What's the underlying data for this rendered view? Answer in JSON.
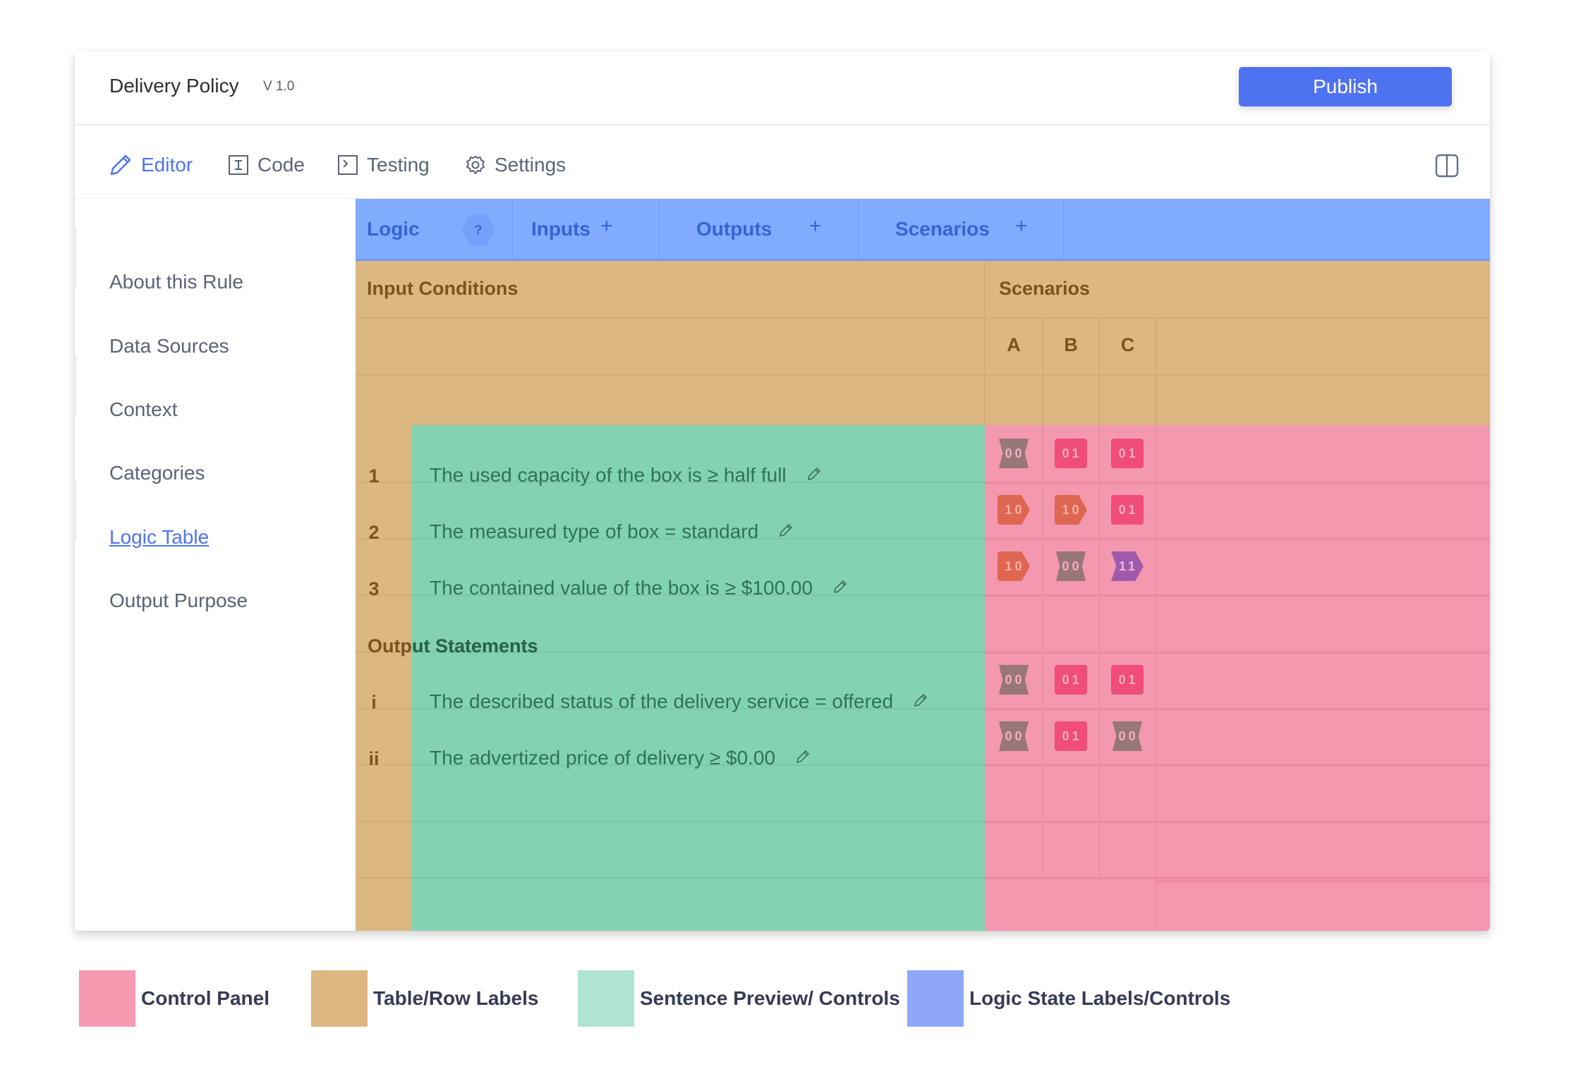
{
  "header": {
    "title": "Delivery Policy",
    "version": "V 1.0",
    "publish_label": "Publish"
  },
  "tabs": [
    {
      "label": "Editor",
      "icon": "pencil-icon",
      "active": true
    },
    {
      "label": "Code",
      "icon": "code-cursor-icon",
      "active": false
    },
    {
      "label": "Testing",
      "icon": "terminal-icon",
      "active": false
    },
    {
      "label": "Settings",
      "icon": "gear-icon",
      "active": false
    }
  ],
  "split_view_icon": "split-panel-icon",
  "sidebar": {
    "items": [
      {
        "label": "About this Rule",
        "active": false
      },
      {
        "label": "Data Sources",
        "active": false
      },
      {
        "label": "Context",
        "active": false
      },
      {
        "label": "Categories",
        "active": false
      },
      {
        "label": "Logic Table",
        "active": true
      },
      {
        "label": "Output Purpose",
        "active": false
      }
    ]
  },
  "logic_bar": {
    "logic_label": "Logic",
    "help_label": "?",
    "inputs_label": "Inputs",
    "outputs_label": "Outputs",
    "scenarios_label": "Scenarios",
    "add_label": "+"
  },
  "table": {
    "input_conditions_label": "Input Conditions",
    "scenarios_label": "Scenarios",
    "scenario_columns": [
      "A",
      "B",
      "C"
    ],
    "inputs": [
      {
        "number": "1",
        "sentence": "The used capacity of the box is ≥ half full",
        "states": [
          "00",
          "01",
          "01"
        ]
      },
      {
        "number": "2",
        "sentence": "The measured type of box = standard",
        "states": [
          "10",
          "10",
          "01"
        ]
      },
      {
        "number": "3",
        "sentence": "The contained value of the box is ≥ $100.00",
        "states": [
          "10",
          "00",
          "11"
        ]
      }
    ],
    "output_statements_label": "Output Statements",
    "outputs": [
      {
        "number": "i",
        "sentence": "The described status of the delivery service = offered",
        "states": [
          "00",
          "01",
          "01"
        ]
      },
      {
        "number": "ii",
        "sentence": "The advertized price of delivery ≥ $0.00",
        "states": [
          "00",
          "01",
          "00"
        ]
      }
    ]
  },
  "legend": [
    {
      "label": "Control Panel",
      "color": "#f59ab1"
    },
    {
      "label": "Table/Row Labels",
      "color": "#dcb781"
    },
    {
      "label": "Sentence Preview/ Controls",
      "color": "#b0e3d1"
    },
    {
      "label": "Logic State Labels/Controls",
      "color": "#8ea7f7"
    }
  ],
  "colors": {
    "accent": "#4f73f0",
    "control_panel": "#f398af",
    "row_labels": "#dcb781",
    "sentence_preview": "#83d3b3",
    "logic_state": "#80abff",
    "state_00": "#987777",
    "state_01": "#f04d78",
    "state_10": "#df6650",
    "state_11": "#a05aac"
  }
}
